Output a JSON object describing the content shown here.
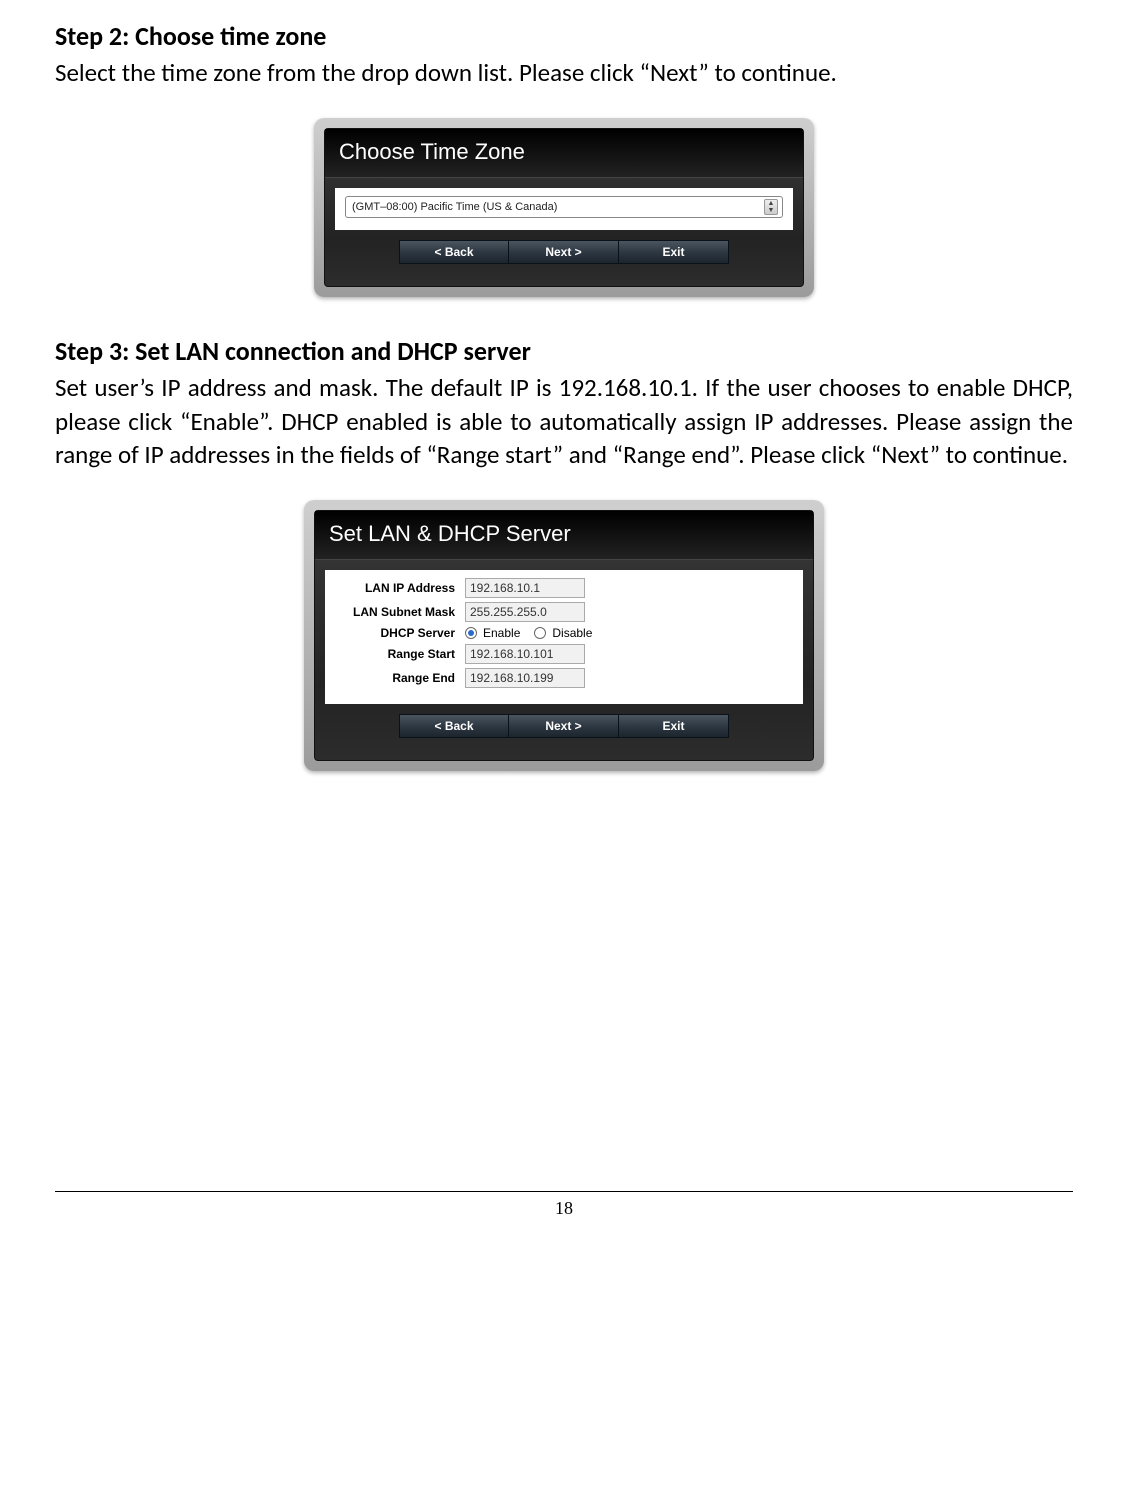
{
  "step2": {
    "heading": "Step 2: Choose time zone",
    "body": "Select the time zone from the drop down list. Please click “Next” to continue.",
    "panel_title": "Choose Time Zone",
    "timezone_value": "(GMT–08:00) Pacific Time (US & Canada)",
    "buttons": {
      "back": "< Back",
      "next": "Next >",
      "exit": "Exit"
    }
  },
  "step3": {
    "heading": "Step 3: Set LAN connection and DHCP server",
    "body": "Set user’s IP address and mask. The default IP is 192.168.10.1. If the user chooses to enable DHCP, please click “Enable”. DHCP enabled is able to automatically assign IP addresses. Please assign the range of IP addresses in the fields of “Range start” and “Range end”. Please click “Next” to continue.",
    "panel_title": "Set LAN & DHCP Server",
    "fields": {
      "lan_ip_label": "LAN IP Address",
      "lan_ip_value": "192.168.10.1",
      "subnet_label": "LAN Subnet Mask",
      "subnet_value": "255.255.255.0",
      "dhcp_label": "DHCP Server",
      "dhcp_enable": "Enable",
      "dhcp_disable": "Disable",
      "range_start_label": "Range Start",
      "range_start_value": "192.168.10.101",
      "range_end_label": "Range End",
      "range_end_value": "192.168.10.199"
    },
    "buttons": {
      "back": "< Back",
      "next": "Next >",
      "exit": "Exit"
    }
  },
  "page_number": "18"
}
